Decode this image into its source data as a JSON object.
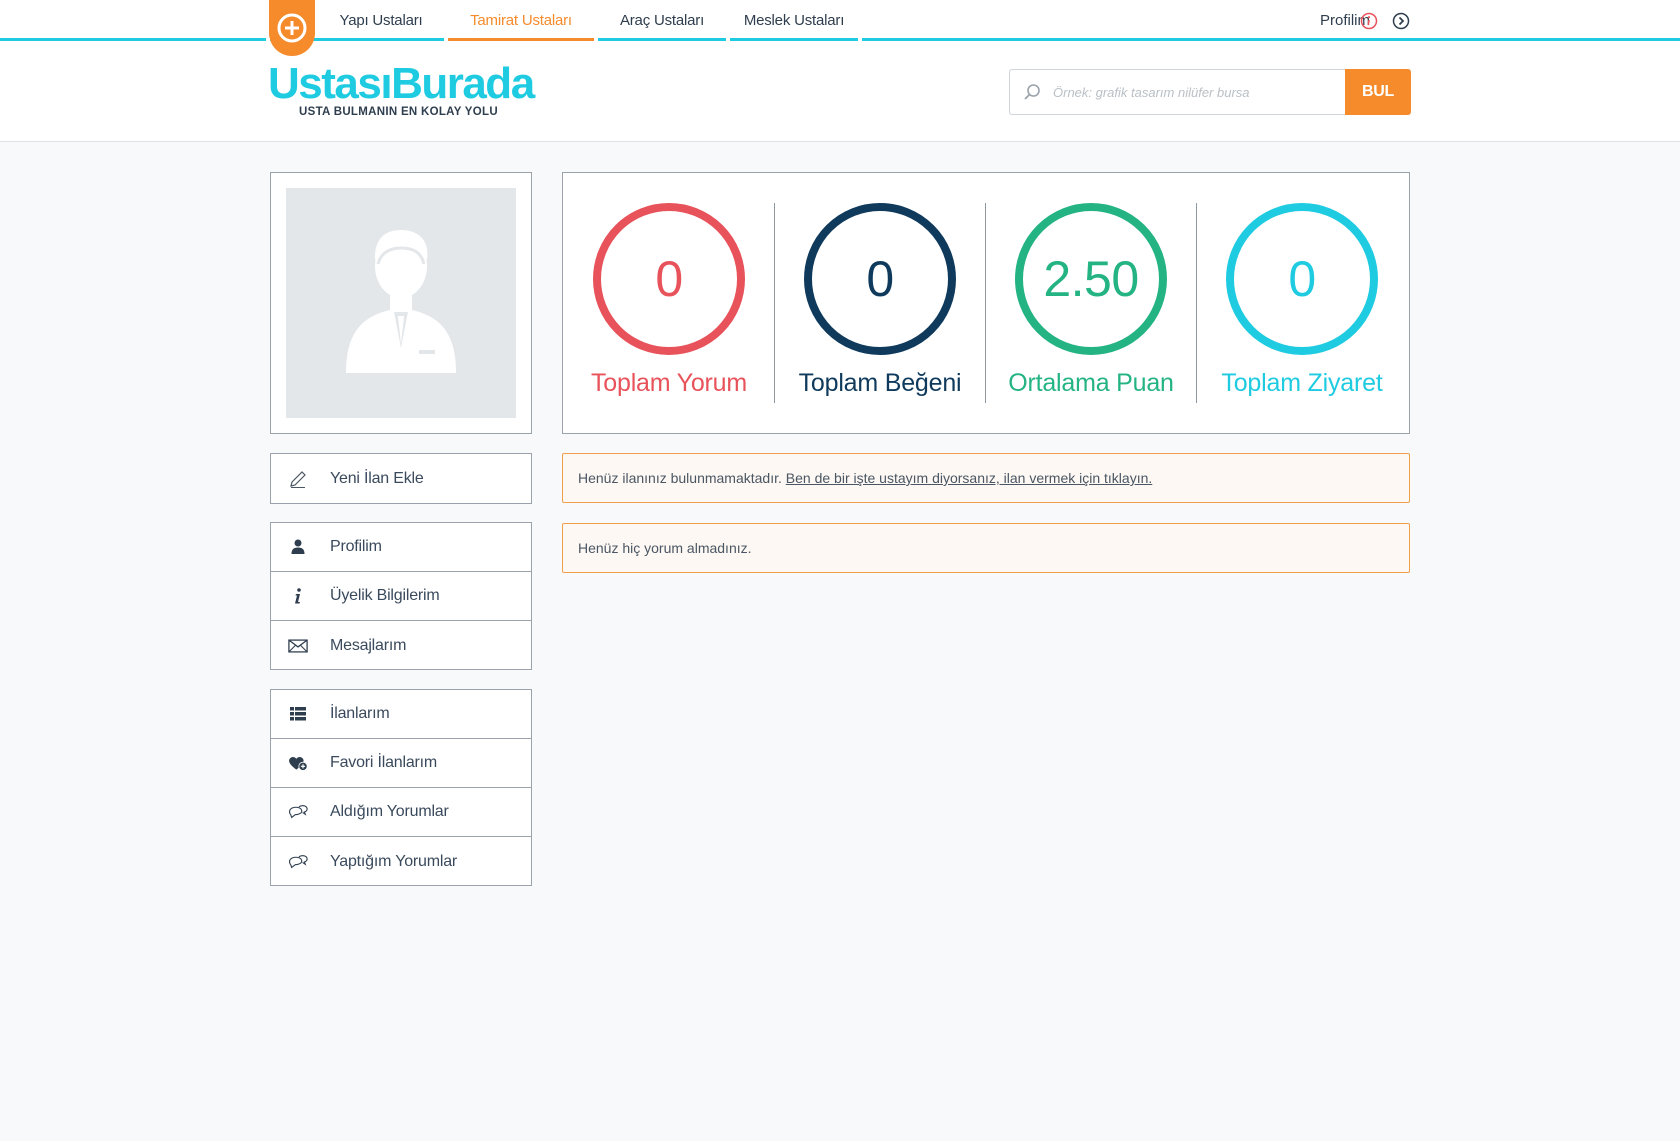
{
  "nav": {
    "items": [
      {
        "label": "Yapı Ustaları",
        "active": false
      },
      {
        "label": "Tamirat Ustaları",
        "active": true
      },
      {
        "label": "Araç Ustaları",
        "active": false
      },
      {
        "label": "Meslek Ustaları",
        "active": false
      }
    ],
    "profile_label": "Profilim",
    "accent": "#1ecbe1",
    "active_color": "#f68b2c"
  },
  "logo": {
    "name": "UstasıBurada",
    "tagline": "USTA BULMANIN EN KOLAY YOLU"
  },
  "search": {
    "placeholder": "Örnek: grafik tasarım nilüfer bursa",
    "value": "",
    "button_label": "BUL"
  },
  "sidebar": {
    "primary": [
      {
        "label": "Yeni İlan Ekle",
        "icon": "pencil-icon"
      }
    ],
    "account": [
      {
        "label": "Profilim",
        "icon": "user-icon"
      },
      {
        "label": "Üyelik Bilgilerim",
        "icon": "info-icon"
      },
      {
        "label": "Mesajlarım",
        "icon": "envelope-icon"
      }
    ],
    "listings": [
      {
        "label": "İlanlarım",
        "icon": "list-icon"
      },
      {
        "label": "Favori İlanlarım",
        "icon": "heart-plus-icon"
      },
      {
        "label": "Aldığım Yorumlar",
        "icon": "comments-icon"
      },
      {
        "label": "Yaptığım Yorumlar",
        "icon": "comments-icon"
      }
    ]
  },
  "stats": [
    {
      "value": "0",
      "label": "Toplam Yorum",
      "color": "#e8535b"
    },
    {
      "value": "0",
      "label": "Toplam Beğeni",
      "color": "#0f3a5c"
    },
    {
      "value": "2.50",
      "label": "Ortalama Puan",
      "color": "#24b383"
    },
    {
      "value": "0",
      "label": "Toplam Ziyaret",
      "color": "#1ecbe1"
    }
  ],
  "alerts": {
    "listings_text": "Henüz ilanınız bulunmamaktadır.",
    "listings_link": "Ben de bir işte ustayım diyorsanız, ilan vermek için tıklayın.",
    "comments_text": "Henüz hiç yorum almadınız."
  }
}
